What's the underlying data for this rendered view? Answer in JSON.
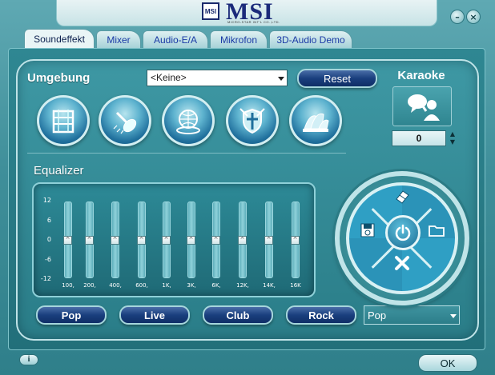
{
  "brand": {
    "logo_text": "MSI",
    "badge_text": "MSI",
    "subtitle": "MICRO-STAR INT'L CO.,LTD."
  },
  "window": {
    "minimize": "–",
    "close": "×"
  },
  "tabs": [
    {
      "label": "Soundeffekt",
      "active": true
    },
    {
      "label": "Mixer",
      "active": false
    },
    {
      "label": "Audio-E/A",
      "active": false
    },
    {
      "label": "Mikrofon",
      "active": false
    },
    {
      "label": "3D-Audio Demo",
      "active": false
    }
  ],
  "environment": {
    "label": "Umgebung",
    "selected": "<Keine>",
    "reset_label": "Reset",
    "presets": [
      {
        "name": "bathroom-icon"
      },
      {
        "name": "shower-icon"
      },
      {
        "name": "stadium-icon"
      },
      {
        "name": "arena-icon"
      },
      {
        "name": "opera-house-icon"
      }
    ]
  },
  "karaoke": {
    "label": "Karaoke",
    "value": "0",
    "up": "▲",
    "down": "▼"
  },
  "equalizer": {
    "label": "Equalizer",
    "scale": [
      "12",
      "6",
      "0",
      "-6",
      "-12"
    ],
    "knob_glyph": "^",
    "bands": [
      {
        "freq": "100,",
        "gain": 0
      },
      {
        "freq": "200,",
        "gain": 0
      },
      {
        "freq": "400,",
        "gain": 0
      },
      {
        "freq": "600,",
        "gain": 0
      },
      {
        "freq": "1K,",
        "gain": 0
      },
      {
        "freq": "3K,",
        "gain": 0
      },
      {
        "freq": "6K,",
        "gain": 0
      },
      {
        "freq": "12K,",
        "gain": 0
      },
      {
        "freq": "14K,",
        "gain": 0
      },
      {
        "freq": "16K",
        "gain": 0
      }
    ],
    "presets": [
      "Pop",
      "Live",
      "Club",
      "Rock"
    ],
    "preset_selected": "Pop"
  },
  "wheel": {
    "top": "eraser-icon",
    "left": "save-icon",
    "right": "folder-icon",
    "bottom": "delete-icon",
    "center": "power-icon"
  },
  "footer": {
    "info_label": "i",
    "ok_label": "OK"
  },
  "colors": {
    "accent_blue": "#1a3f7e",
    "panel_teal": "#2f8792",
    "logo_blue": "#1b2a7a"
  }
}
